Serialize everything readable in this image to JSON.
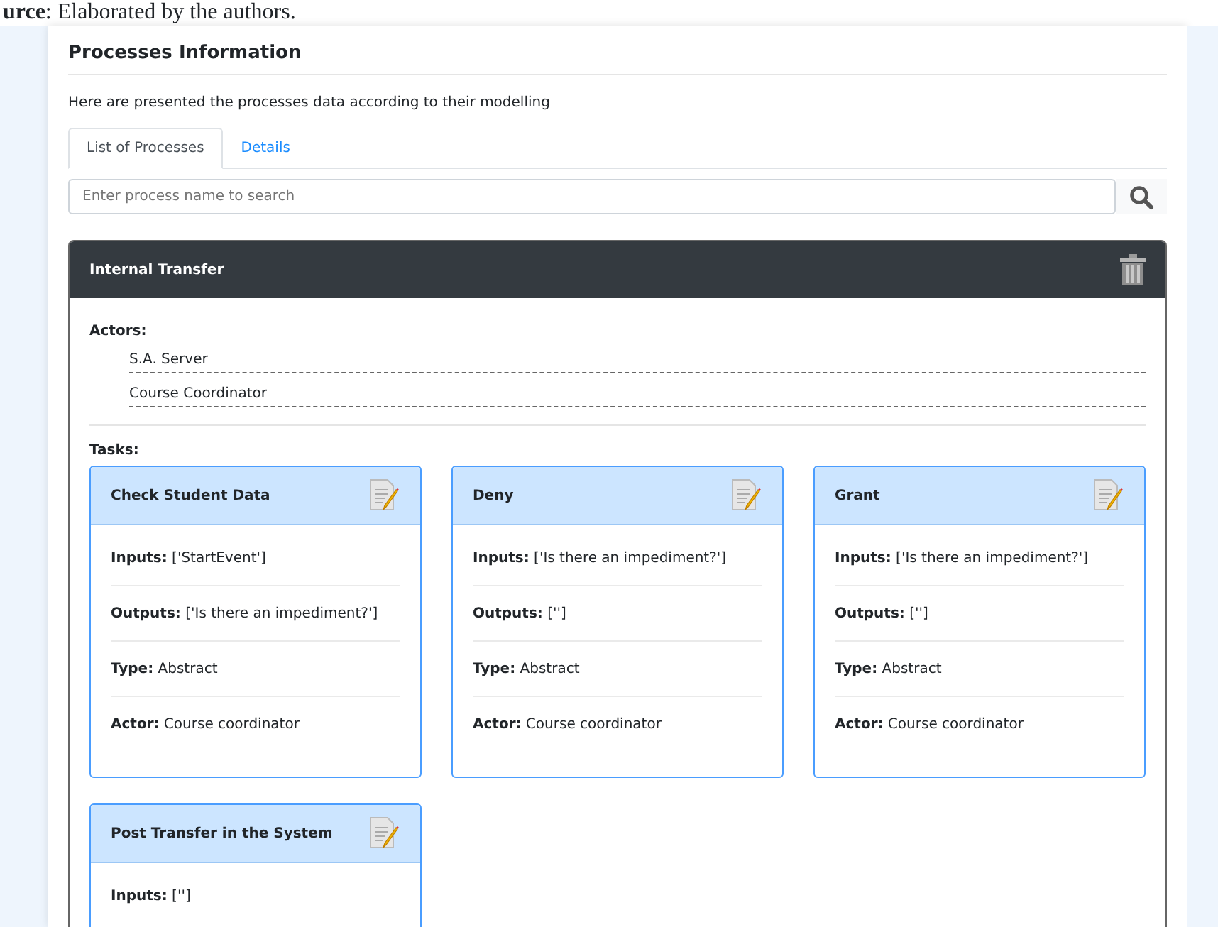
{
  "caption": "**urce**: Elaborated by the authors.",
  "title": "Processes Information",
  "description": "Here are presented the processes data according to their modelling",
  "tabs": [
    {
      "label": "List of Processes",
      "selected": true
    },
    {
      "label": "Details",
      "selected": false
    }
  ],
  "search": {
    "placeholder": "Enter process name to search"
  },
  "process": {
    "name": "Internal Transfer",
    "actors_label": "Actors:",
    "actors": [
      "S.A. Server",
      "Course Coordinator"
    ],
    "tasks_label": "Tasks:",
    "tasks": [
      {
        "name": "Check Student Data",
        "fields": [
          "**Inputs:** ['StartEvent']",
          "**Outputs:** ['Is there an impediment?']",
          "**Type:** Abstract",
          "**Actor:** Course coordinator"
        ]
      },
      {
        "name": "Deny",
        "fields": [
          "**Inputs:** ['Is there an impediment?']",
          "**Outputs:** ['']",
          "**Type:** Abstract",
          "**Actor:** Course coordinator"
        ]
      },
      {
        "name": "Grant",
        "fields": [
          "**Inputs:** ['Is there an impediment?']",
          "**Outputs:** ['']",
          "**Type:** Abstract",
          "**Actor:** Course coordinator"
        ]
      },
      {
        "name": "Post Transfer in the System",
        "fields": [
          "**Inputs:** ['']"
        ]
      }
    ]
  }
}
